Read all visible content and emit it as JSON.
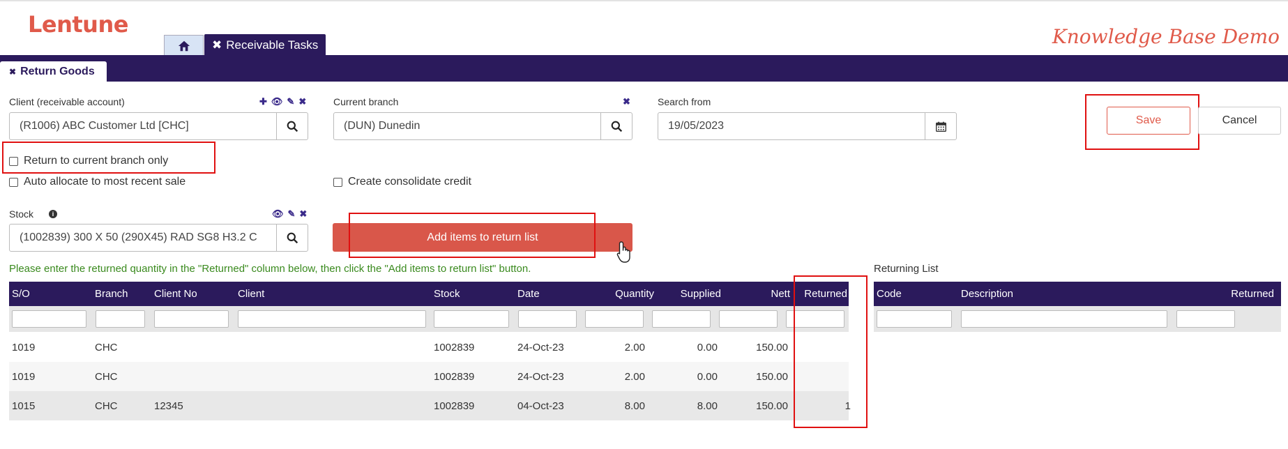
{
  "header": {
    "logo": "Lentune",
    "brand_tagline": "Knowledge Base Demo",
    "tabs": [
      {
        "label": "Receivable Tasks"
      }
    ],
    "subtab": "Return Goods"
  },
  "form": {
    "client": {
      "label": "Client (receivable account)",
      "value": "(R1006) ABC Customer Ltd [CHC]"
    },
    "branch": {
      "label": "Current branch",
      "value": "(DUN) Dunedin"
    },
    "search_from": {
      "label": "Search from",
      "value": "19/05/2023"
    },
    "checkboxes": {
      "return_current_branch": "Return to current branch only",
      "auto_allocate": "Auto allocate to most recent sale",
      "consolidate_credit": "Create consolidate credit"
    },
    "stock": {
      "label": "Stock",
      "value": "(1002839) 300 X 50 (290X45) RAD SG8 H3.2 C"
    },
    "save_label": "Save",
    "cancel_label": "Cancel",
    "add_items_label": "Add items to return list"
  },
  "hint": "Please enter the returned quantity in the \"Returned\" column below, then click the \"Add items to return list\" button.",
  "sales_table": {
    "columns": [
      "S/O",
      "Branch",
      "Client No",
      "Client",
      "Stock",
      "Date",
      "Quantity",
      "Supplied",
      "Nett",
      "Returned"
    ],
    "rows": [
      {
        "so": "1019",
        "branch": "CHC",
        "client_no": "",
        "client": "",
        "stock": "1002839",
        "date": "24-Oct-23",
        "quantity": "2.00",
        "supplied": "0.00",
        "nett": "150.00",
        "returned": ""
      },
      {
        "so": "1019",
        "branch": "CHC",
        "client_no": "",
        "client": "",
        "stock": "1002839",
        "date": "24-Oct-23",
        "quantity": "2.00",
        "supplied": "0.00",
        "nett": "150.00",
        "returned": ""
      },
      {
        "so": "1015",
        "branch": "CHC",
        "client_no": "12345",
        "client": "",
        "stock": "1002839",
        "date": "04-Oct-23",
        "quantity": "8.00",
        "supplied": "8.00",
        "nett": "150.00",
        "returned": "1"
      }
    ]
  },
  "returning_list": {
    "title": "Returning List",
    "columns": [
      "Code",
      "Description",
      "Returned"
    ]
  },
  "colors": {
    "primary": "#2b1a5c",
    "accent": "#e05a4a",
    "hint": "#3a8a1e",
    "highlight_outline": "#e01010"
  }
}
